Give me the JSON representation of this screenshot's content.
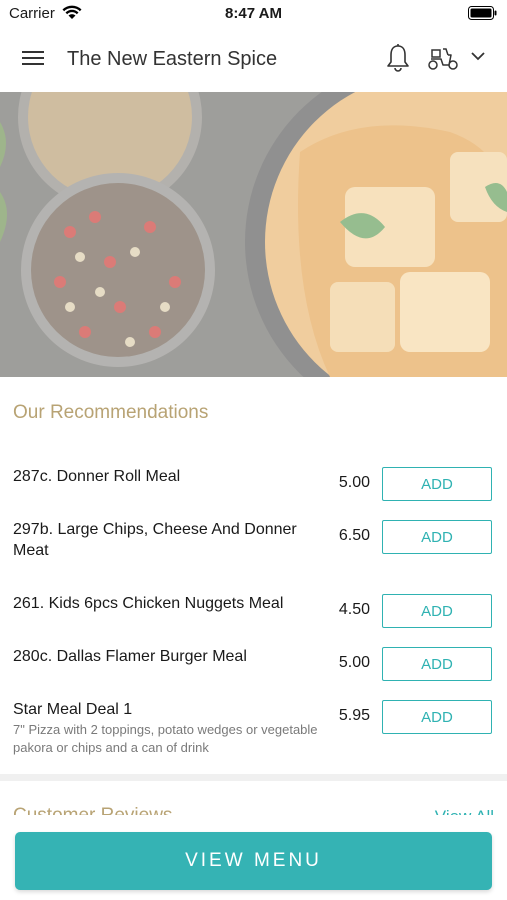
{
  "status_bar": {
    "carrier": "Carrier",
    "time": "8:47 AM"
  },
  "header": {
    "title": "The New Eastern Spice"
  },
  "recommendations": {
    "title": "Our Recommendations",
    "items": [
      {
        "name": "287c. Donner Roll Meal",
        "description": "",
        "price": "5.00",
        "button": "ADD"
      },
      {
        "name": "297b. Large Chips, Cheese And Donner Meat",
        "description": "",
        "price": "6.50",
        "button": "ADD"
      },
      {
        "name": "261. Kids 6pcs Chicken Nuggets Meal",
        "description": "",
        "price": "4.50",
        "button": "ADD"
      },
      {
        "name": "280c. Dallas Flamer Burger Meal",
        "description": "",
        "price": "5.00",
        "button": "ADD"
      },
      {
        "name": "Star Meal Deal 1",
        "description": "7\" Pizza with 2 toppings, potato wedges or vegetable pakora or chips and a can of drink",
        "price": "5.95",
        "button": "ADD"
      }
    ]
  },
  "reviews": {
    "title": "Customer Reviews",
    "view_all": "View All"
  },
  "footer": {
    "view_menu": "VIEW MENU"
  },
  "colors": {
    "accent": "#35b3b4",
    "section_title": "#b8a374"
  }
}
